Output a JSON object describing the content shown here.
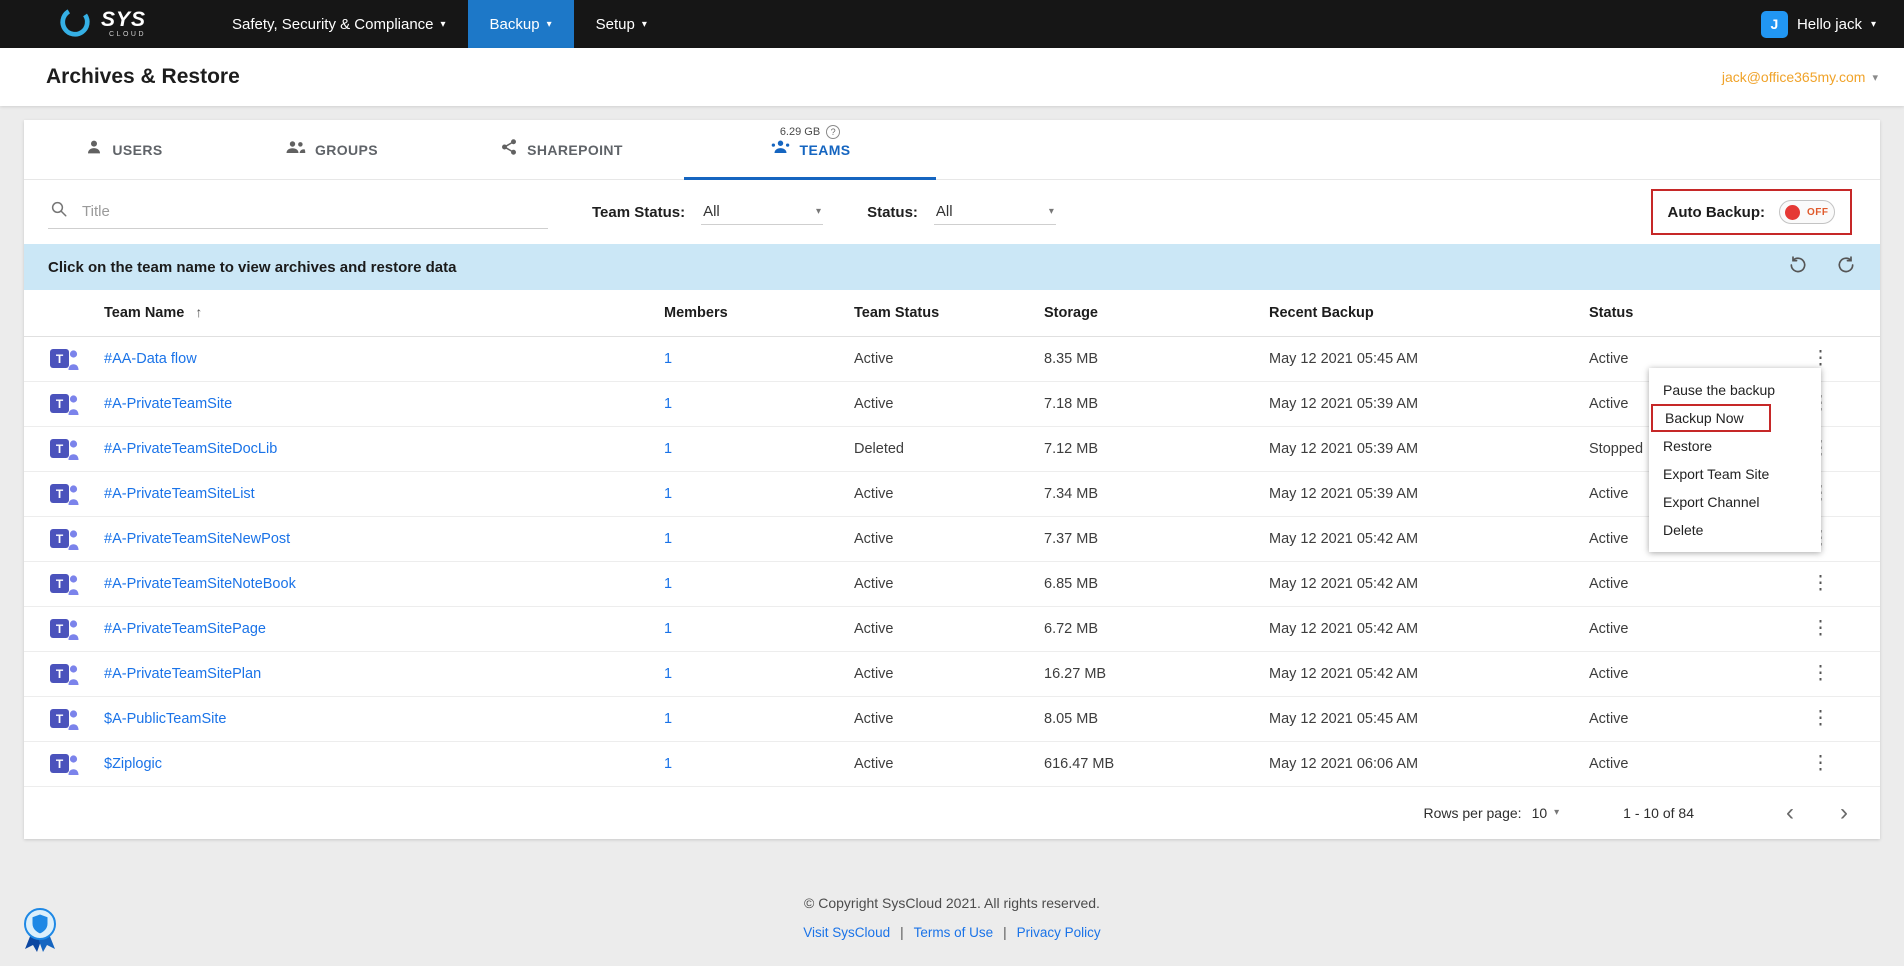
{
  "topnav": {
    "brand": {
      "sys": "SYS",
      "cloud": "CLOUD"
    },
    "items": [
      {
        "label": "Safety, Security & Compliance"
      },
      {
        "label": "Backup",
        "active": true
      },
      {
        "label": "Setup"
      }
    ],
    "user": {
      "initial": "J",
      "greeting": "Hello jack"
    }
  },
  "header": {
    "title": "Archives & Restore",
    "account_email": "jack@office365my.com"
  },
  "tabs": {
    "items": [
      {
        "label": "USERS"
      },
      {
        "label": "GROUPS"
      },
      {
        "label": "SHAREPOINT"
      },
      {
        "label": "TEAMS",
        "active": true,
        "size": "6.29 GB"
      }
    ]
  },
  "filters": {
    "search_placeholder": "Title",
    "team_status_label": "Team Status:",
    "team_status_value": "All",
    "status_label": "Status:",
    "status_value": "All",
    "auto_backup_label": "Auto Backup:",
    "auto_backup_state": "OFF"
  },
  "info_bar": {
    "message": "Click on the team name to view archives and restore data"
  },
  "table": {
    "headers": [
      "Team Name",
      "Members",
      "Team Status",
      "Storage",
      "Recent Backup",
      "Status"
    ],
    "rows": [
      {
        "name": "#AA-Data flow",
        "members": "1",
        "team_status": "Active",
        "storage": "8.35 MB",
        "recent_backup": "May 12 2021 05:45 AM",
        "status": "Active"
      },
      {
        "name": "#A-PrivateTeamSite",
        "members": "1",
        "team_status": "Active",
        "storage": "7.18 MB",
        "recent_backup": "May 12 2021 05:39 AM",
        "status": "Active"
      },
      {
        "name": "#A-PrivateTeamSiteDocLib",
        "members": "1",
        "team_status": "Deleted",
        "storage": "7.12 MB",
        "recent_backup": "May 12 2021 05:39 AM",
        "status": "Stopped"
      },
      {
        "name": "#A-PrivateTeamSiteList",
        "members": "1",
        "team_status": "Active",
        "storage": "7.34 MB",
        "recent_backup": "May 12 2021 05:39 AM",
        "status": "Active"
      },
      {
        "name": "#A-PrivateTeamSiteNewPost",
        "members": "1",
        "team_status": "Active",
        "storage": "7.37 MB",
        "recent_backup": "May 12 2021 05:42 AM",
        "status": "Active"
      },
      {
        "name": "#A-PrivateTeamSiteNoteBook",
        "members": "1",
        "team_status": "Active",
        "storage": "6.85 MB",
        "recent_backup": "May 12 2021 05:42 AM",
        "status": "Active"
      },
      {
        "name": "#A-PrivateTeamSitePage",
        "members": "1",
        "team_status": "Active",
        "storage": "6.72 MB",
        "recent_backup": "May 12 2021 05:42 AM",
        "status": "Active"
      },
      {
        "name": "#A-PrivateTeamSitePlan",
        "members": "1",
        "team_status": "Active",
        "storage": "16.27 MB",
        "recent_backup": "May 12 2021 05:42 AM",
        "status": "Active"
      },
      {
        "name": "$A-PublicTeamSite",
        "members": "1",
        "team_status": "Active",
        "storage": "8.05 MB",
        "recent_backup": "May 12 2021 05:45 AM",
        "status": "Active"
      },
      {
        "name": "$Ziplogic",
        "members": "1",
        "team_status": "Active",
        "storage": "616.47 MB",
        "recent_backup": "May 12 2021 06:06 AM",
        "status": "Active"
      }
    ]
  },
  "context_menu": {
    "items": [
      "Pause the backup",
      "Backup Now",
      "Restore",
      "Export Team Site",
      "Export Channel",
      "Delete"
    ],
    "highlighted": "Backup Now"
  },
  "pagination": {
    "rows_per_page_label": "Rows per page:",
    "rows_per_page_value": "10",
    "range": "1 - 10 of 84"
  },
  "footer": {
    "copyright": "© Copyright SysCloud 2021. All rights reserved.",
    "separator": "|",
    "links": [
      "Visit SysCloud",
      "Terms of Use",
      "Privacy Policy"
    ]
  },
  "icons": {
    "caret_down": "▾",
    "sort_asc": "↑",
    "kebab": "⋮",
    "chevron_left": "‹",
    "chevron_right": "›",
    "help": "?"
  }
}
